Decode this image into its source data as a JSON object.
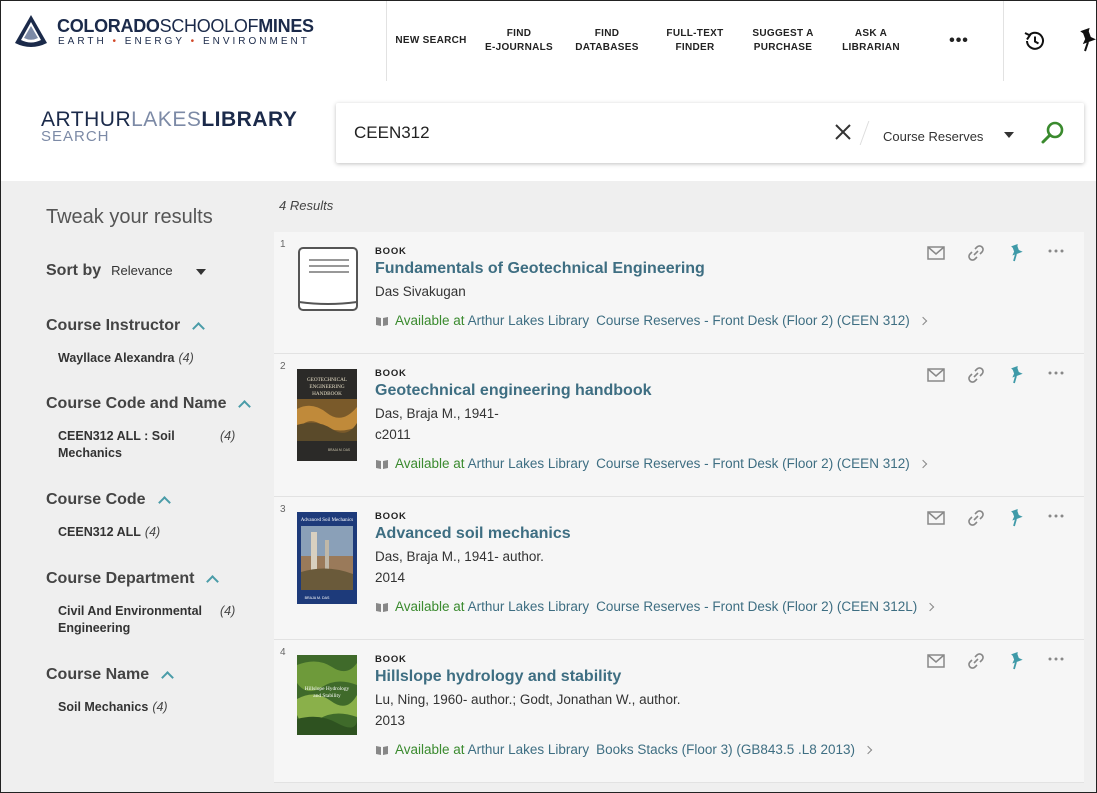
{
  "header": {
    "logo": {
      "title_bold": "COLORADO",
      "title_thin": "SCHOOL",
      "title_of": "OF",
      "title_mines": "MINES",
      "tagline": [
        "EARTH",
        "ENERGY",
        "ENVIRONMENT"
      ],
      "tagline_dot": "•"
    },
    "nav": [
      {
        "label": "NEW SEARCH"
      },
      {
        "label": "FIND\nE-JOURNALS"
      },
      {
        "label": "FIND\nDATABASES"
      },
      {
        "label": "FULL-TEXT\nFINDER"
      },
      {
        "label": "SUGGEST A\nPURCHASE"
      },
      {
        "label": "ASK A\nLIBRARIAN"
      }
    ],
    "more_label": "•••",
    "accent_color": "#4a9ca8"
  },
  "search": {
    "library_title_a": "ARTHUR",
    "library_title_b": "LAKES",
    "library_title_c": "LIBRARY",
    "library_sub": "SEARCH",
    "query": "CEEN312",
    "scope": "Course Reserves"
  },
  "sidebar": {
    "title": "Tweak your results",
    "sort_label": "Sort by",
    "sort_value": "Relevance",
    "facets": [
      {
        "title": "Course Instructor",
        "items": [
          {
            "label": "Wayllace Alexandra",
            "count": "(4)"
          }
        ]
      },
      {
        "title": "Course Code and Name",
        "items": [
          {
            "label": "CEEN312 ALL : Soil Mechanics",
            "count": "(4)"
          }
        ]
      },
      {
        "title": "Course Code",
        "items": [
          {
            "label": "CEEN312 ALL",
            "count": "(4)"
          }
        ]
      },
      {
        "title": "Course Department",
        "items": [
          {
            "label": "Civil And Environmental Engineering",
            "count": "(4)"
          }
        ]
      },
      {
        "title": "Course Name",
        "items": [
          {
            "label": "Soil Mechanics",
            "count": "(4)"
          }
        ]
      }
    ]
  },
  "results": {
    "count_label": "4 Results",
    "items": [
      {
        "num": "1",
        "type": "BOOK",
        "title": "Fundamentals of Geotechnical Engineering",
        "author": "Das Sivakugan",
        "date": "",
        "avail_status": "Available at",
        "avail_library": "Arthur Lakes Library",
        "avail_location": "Course Reserves - Front Desk (Floor 2) (CEEN 312)",
        "thumb": "placeholder"
      },
      {
        "num": "2",
        "type": "BOOK",
        "title": "Geotechnical engineering handbook",
        "author": "Das, Braja M., 1941-",
        "date": "c2011",
        "avail_status": "Available at",
        "avail_library": "Arthur Lakes Library",
        "avail_location": "Course Reserves - Front Desk (Floor 2) (CEEN 312)",
        "thumb": "handbook",
        "thumb_title_1": "GEOTECHNICAL",
        "thumb_title_2": "ENGINEERING",
        "thumb_title_3": "HANDBOOK",
        "thumb_author": "BRAJA M. DAS"
      },
      {
        "num": "3",
        "type": "BOOK",
        "title": "Advanced soil mechanics",
        "author": "Das, Braja M., 1941- author.",
        "date": "2014",
        "avail_status": "Available at",
        "avail_library": "Arthur Lakes Library",
        "avail_location": "Course Reserves - Front Desk (Floor 2) (CEEN 312L)",
        "thumb": "advanced",
        "thumb_title": "Advanced Soil Mechanics",
        "thumb_author": "BRAJA M. DAS"
      },
      {
        "num": "4",
        "type": "BOOK",
        "title": "Hillslope hydrology and stability",
        "author": "Lu, Ning, 1960- author.; Godt, Jonathan W., author.",
        "date": "2013",
        "avail_status": "Available at",
        "avail_library": "Arthur Lakes Library",
        "avail_location": "Books Stacks (Floor 3) (GB843.5 .L8 2013)",
        "thumb": "hillslope",
        "thumb_title_1": "Hillslope Hydrology",
        "thumb_title_2": "and Stability"
      }
    ],
    "action_icons": [
      "email-icon",
      "link-icon",
      "pin-icon",
      "more-icon"
    ]
  }
}
